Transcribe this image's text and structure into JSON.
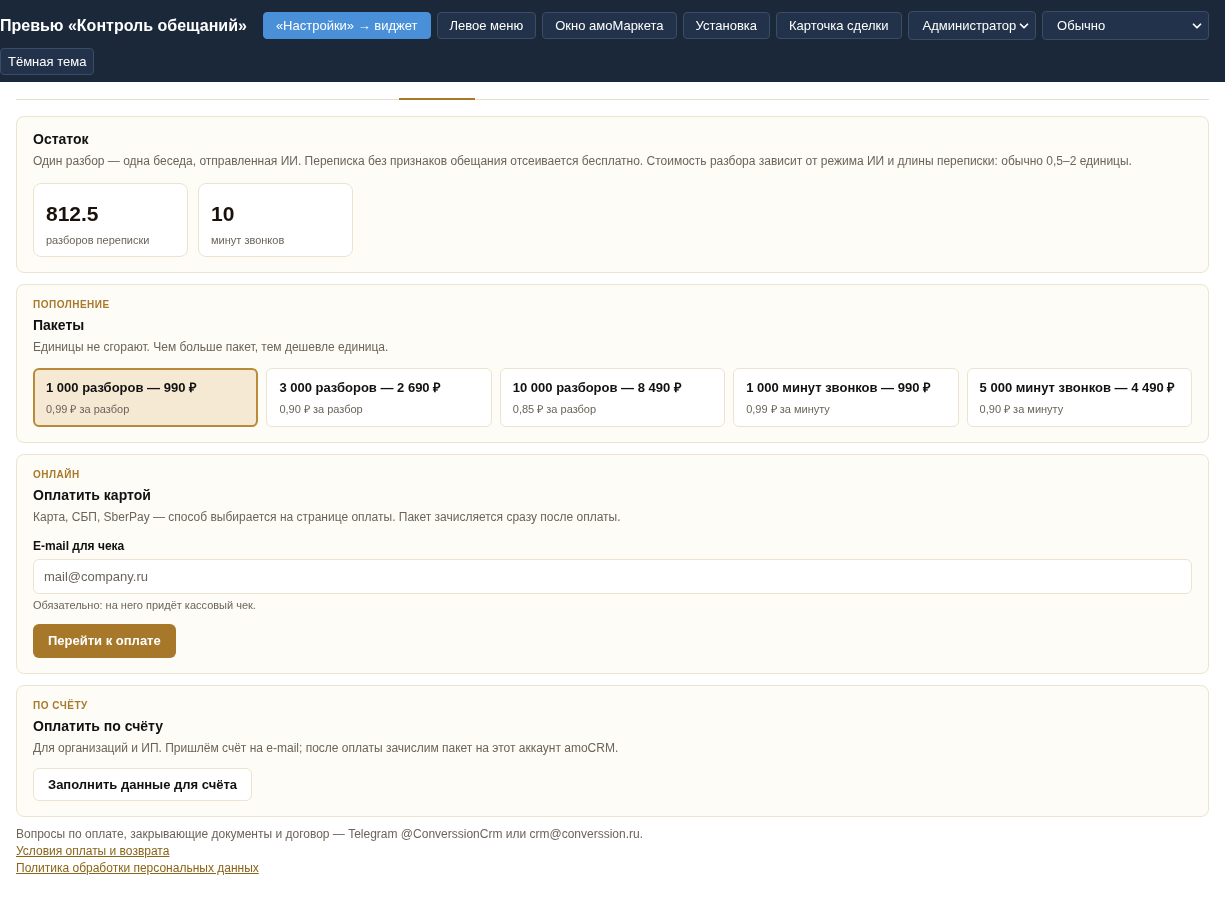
{
  "header": {
    "title": "Превью «Контроль обещаний»",
    "buttons": [
      {
        "label": "«Настройки» → виджет",
        "selected": true
      },
      {
        "label": "Левое меню",
        "selected": false
      },
      {
        "label": "Окно амоМаркета",
        "selected": false
      },
      {
        "label": "Установка",
        "selected": false
      },
      {
        "label": "Карточка сделки",
        "selected": false
      }
    ],
    "selects": [
      {
        "value": "Администратор",
        "kind": "narrow"
      },
      {
        "value": "Обычно",
        "kind": "wide"
      }
    ],
    "theme_button": "Тёмная тема"
  },
  "balance": {
    "title": "Остаток",
    "description": "Один разбор — одна беседа, отправленная ИИ. Переписка без признаков обещания отсеивается бесплатно. Стоимость разбора зависит от режима ИИ и длины переписки: обычно 0,5–2 единицы.",
    "stats": [
      {
        "value": "812.5",
        "label": "разборов переписки"
      },
      {
        "value": "10",
        "label": "минут звонков"
      }
    ]
  },
  "packages": {
    "eyebrow": "ПОПОЛНЕНИЕ",
    "title": "Пакеты",
    "description": "Единицы не сгорают. Чем больше пакет, тем дешевле единица.",
    "items": [
      {
        "name": "1 000 разборов — 990 ₽",
        "unit_price": "0,99 ₽ за разбор",
        "selected": true
      },
      {
        "name": "3 000 разборов — 2 690 ₽",
        "unit_price": "0,90 ₽ за разбор",
        "selected": false
      },
      {
        "name": "10 000 разборов — 8 490 ₽",
        "unit_price": "0,85 ₽ за разбор",
        "selected": false
      },
      {
        "name": "1 000 минут звонков — 990 ₽",
        "unit_price": "0,99 ₽ за минуту",
        "selected": false
      },
      {
        "name": "5 000 минут звонков — 4 490 ₽",
        "unit_price": "0,90 ₽ за минуту",
        "selected": false
      }
    ]
  },
  "card_payment": {
    "eyebrow": "ОНЛАЙН",
    "title": "Оплатить картой",
    "description": "Карта, СБП, SberPay — способ выбирается на странице оплаты. Пакет зачисляется сразу после оплаты.",
    "email_label": "E-mail для чека",
    "email_placeholder": "mail@company.ru",
    "hint": "Обязательно: на него придёт кассовый чек.",
    "button": "Перейти к оплате"
  },
  "invoice_payment": {
    "eyebrow": "ПО СЧЁТУ",
    "title": "Оплатить по счёту",
    "description": "Для организаций и ИП. Пришлём счёт на e-mail; после оплаты зачислим пакет на этот аккаунт amoCRM.",
    "button": "Заполнить данные для счёта"
  },
  "footer": {
    "note": "Вопросы по оплате, закрывающие документы и договор — Telegram @ConverssionCrm или crm@converssion.ru.",
    "links": [
      "Условия оплаты и возврата",
      "Политика обработки персональных данных"
    ]
  }
}
